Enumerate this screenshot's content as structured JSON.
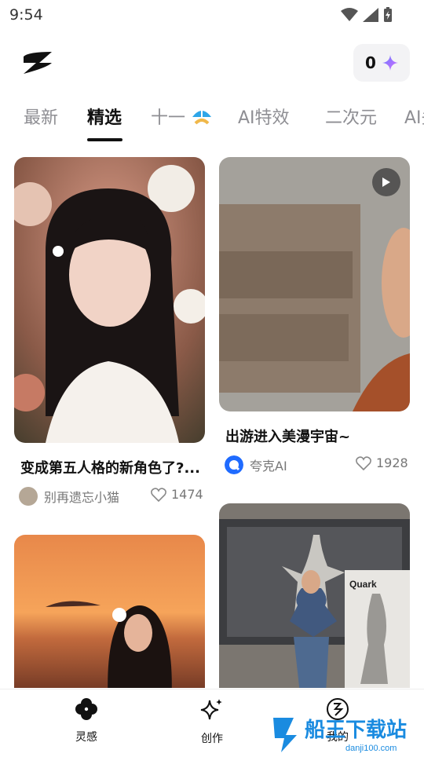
{
  "status_bar": {
    "time": "9:54"
  },
  "header": {
    "coin_count": "0"
  },
  "tabs": [
    {
      "label": "最新"
    },
    {
      "label": "精选"
    },
    {
      "label": "十一"
    },
    {
      "label": "AI特效"
    },
    {
      "label": "二次元"
    },
    {
      "label": "AI头"
    }
  ],
  "feed": {
    "cards": [
      {
        "title": "变成第五人格的新角色了?...",
        "author": "别再遗忘小猫",
        "likes": "1474"
      },
      {
        "title": "出游进入美漫宇宙~",
        "author": "夸克AI",
        "likes": "1928"
      },
      {
        "title": "",
        "author": "",
        "likes": ""
      },
      {
        "title": "",
        "author": "",
        "likes": ""
      }
    ],
    "quark_text": "Quark"
  },
  "bottom_nav": [
    {
      "label": "灵感"
    },
    {
      "label": "创作"
    },
    {
      "label": "我的"
    }
  ],
  "watermark": {
    "main": "船王下载站",
    "sub": "danji100.com"
  }
}
